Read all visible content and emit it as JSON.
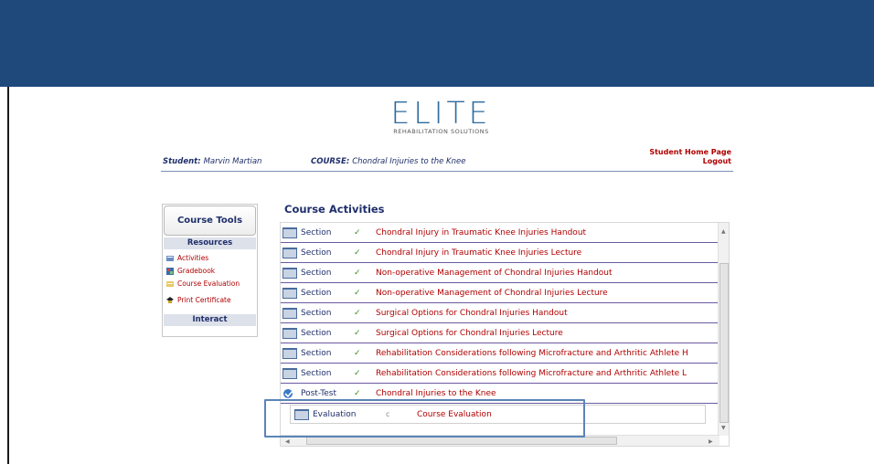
{
  "logo": {
    "word": "ELITE",
    "subtitle": "REHABILITATION SOLUTIONS"
  },
  "header": {
    "student_label": "Student:",
    "student_name": "Marvin Martian",
    "course_label": "COURSE:",
    "course_name": "Chondral Injuries to the Knee",
    "links": [
      "Student Home Page",
      "Logout"
    ]
  },
  "sidebar": {
    "button": "Course Tools",
    "resources_label": "Resources",
    "items": [
      "Activities",
      "Gradebook",
      "Course Evaluation",
      "Print Certificate"
    ],
    "interact_label": "Interact"
  },
  "activities": {
    "title": "Course Activities",
    "rows": [
      {
        "type": "Section",
        "check": "✓",
        "title": "Chondral Injury in Traumatic Knee Injuries Handout"
      },
      {
        "type": "Section",
        "check": "✓",
        "title": "Chondral Injury in Traumatic Knee Injuries Lecture"
      },
      {
        "type": "Section",
        "check": "✓",
        "title": "Non-operative Management of Chondral Injuries Handout"
      },
      {
        "type": "Section",
        "check": "✓",
        "title": "Non-operative Management of Chondral Injuries Lecture"
      },
      {
        "type": "Section",
        "check": "✓",
        "title": "Surgical Options for Chondral Injuries Handout"
      },
      {
        "type": "Section",
        "check": "✓",
        "title": "Surgical Options for Chondral Injuries Lecture"
      },
      {
        "type": "Section",
        "check": "✓",
        "title": "Rehabilitation Considerations following Microfracture and Arthritic Athlete H"
      },
      {
        "type": "Section",
        "check": "✓",
        "title": "Rehabilitation Considerations following Microfracture and Arthritic Athlete L"
      },
      {
        "type": "Post-Test",
        "check": "✓",
        "title": "Chondral Injuries to the Knee"
      }
    ],
    "evaluation": {
      "type": "Evaluation",
      "check": "c",
      "title": "Course Evaluation"
    }
  },
  "colors": {
    "header_band": "#1f487b",
    "link_red": "#b00000",
    "navy_text": "#1f2f6b",
    "check_green": "#3a8a1e",
    "highlight_box": "#5b84b8"
  }
}
